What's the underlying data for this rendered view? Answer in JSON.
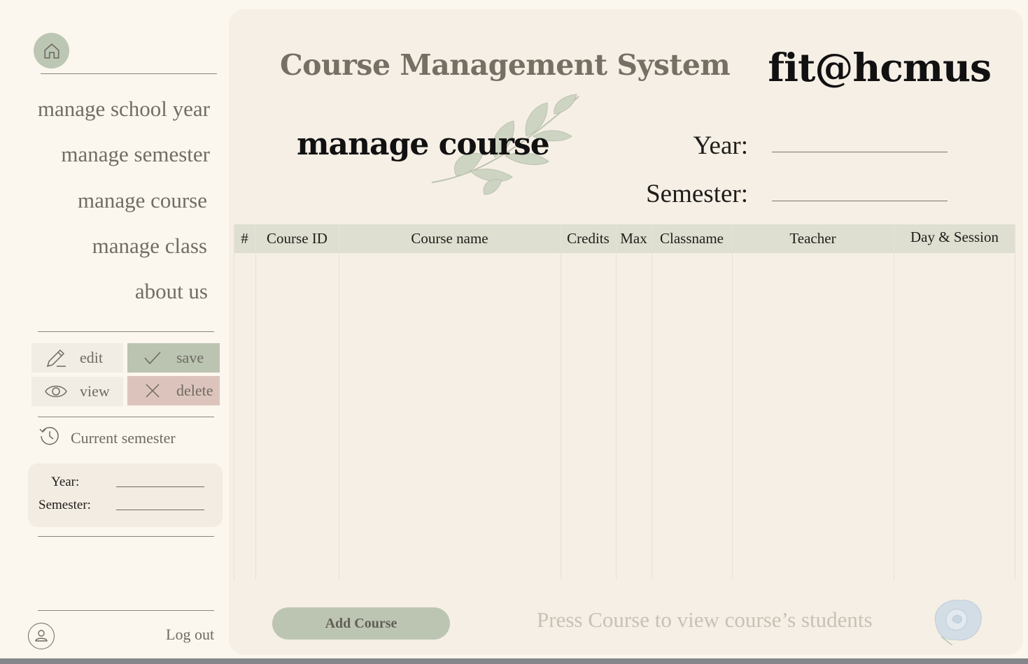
{
  "sidebar": {
    "nav": [
      "manage school year",
      "manage semester",
      "manage course",
      "manage class",
      "about us"
    ],
    "actions": {
      "edit": "edit",
      "save": "save",
      "view": "view",
      "delete": "delete"
    },
    "current_semester": {
      "label": "Current semester",
      "year_label": "Year:",
      "semester_label": "Semester:",
      "year_value": "",
      "semester_value": ""
    },
    "logout": "Log out"
  },
  "header": {
    "system_title": "Course Management System",
    "brand": "fit@hcmus",
    "page_title": "manage course",
    "year_label": "Year:",
    "semester_label": "Semester:",
    "year_value": "",
    "semester_value": ""
  },
  "table": {
    "columns": [
      "#",
      "Course ID",
      "Course name",
      "Credits",
      "Max",
      "Classname",
      "Teacher",
      "Day & Session"
    ],
    "rows": []
  },
  "footer": {
    "add_button": "Add Course",
    "hint": "Press Course to view course’s students"
  },
  "colors": {
    "background": "#fbf6ee",
    "panel": "#f5efe5",
    "accent_green": "#bcc5b2",
    "accent_rose": "#dcc4bc",
    "header_row": "#dedfd0"
  },
  "icons": [
    "home-icon",
    "pencil-icon",
    "check-icon",
    "eye-icon",
    "x-icon",
    "history-icon",
    "user-icon",
    "leaf-decoration",
    "rose-decoration"
  ]
}
